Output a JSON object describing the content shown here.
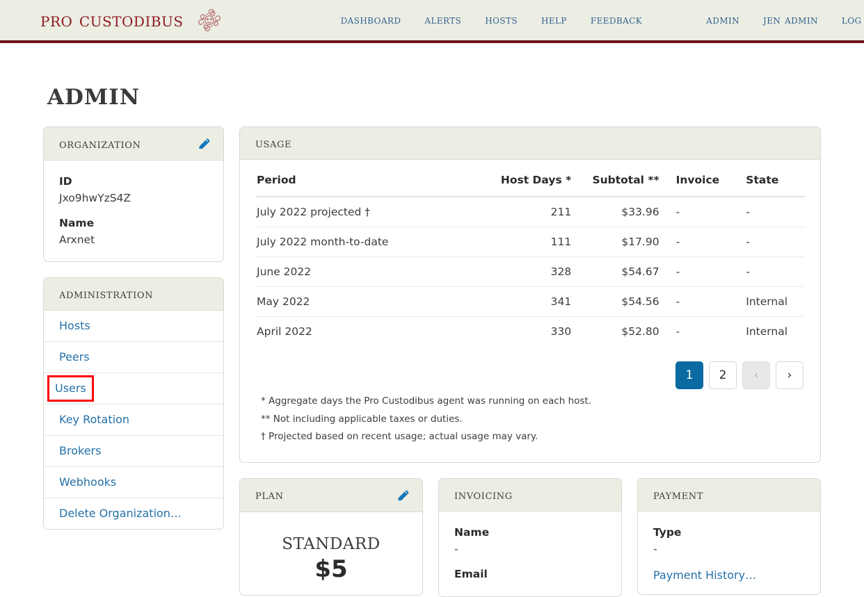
{
  "header": {
    "brand": "Pro Custodibus",
    "brand_icon": "medusa-head-logo",
    "nav_primary": [
      {
        "label": "Dashboard",
        "name": "nav-dashboard"
      },
      {
        "label": "Alerts",
        "name": "nav-alerts"
      },
      {
        "label": "Hosts",
        "name": "nav-hosts"
      },
      {
        "label": "Help",
        "name": "nav-help"
      },
      {
        "label": "Feedback",
        "name": "nav-feedback"
      }
    ],
    "nav_account": [
      {
        "label": "Admin",
        "name": "nav-admin"
      },
      {
        "label": "Jen Admin",
        "name": "nav-jen-admin"
      },
      {
        "label": "Log Out",
        "name": "nav-log-out"
      }
    ],
    "accent_color": "#6d1216",
    "link_color": "#31618e",
    "background": "#eceee4"
  },
  "page": {
    "title": "Admin"
  },
  "organization": {
    "heading": "Organization",
    "edit_icon": "pencil-icon",
    "id_label": "ID",
    "id_value": "Jxo9hwYzS4Z",
    "name_label": "Name",
    "name_value": "Arxnet"
  },
  "administration": {
    "heading": "Administration",
    "items": [
      {
        "label": "Hosts",
        "name": "admin-link-hosts",
        "highlighted": false
      },
      {
        "label": "Peers",
        "name": "admin-link-peers",
        "highlighted": false
      },
      {
        "label": "Users",
        "name": "admin-link-users",
        "highlighted": true
      },
      {
        "label": "Key Rotation",
        "name": "admin-link-key-rotation",
        "highlighted": false
      },
      {
        "label": "Brokers",
        "name": "admin-link-brokers",
        "highlighted": false
      },
      {
        "label": "Webhooks",
        "name": "admin-link-webhooks",
        "highlighted": false
      },
      {
        "label": "Delete Organization…",
        "name": "admin-link-delete-organization",
        "highlighted": false
      }
    ],
    "highlight_color": "#fe0000"
  },
  "usage": {
    "heading": "Usage",
    "columns": [
      "Period",
      "Host Days *",
      "Subtotal **",
      "Invoice",
      "State"
    ],
    "rows": [
      {
        "period": "July 2022 projected †",
        "host_days": "211",
        "subtotal": "$33.96",
        "invoice": "-",
        "state": "-"
      },
      {
        "period": "July 2022 month-to-date",
        "host_days": "111",
        "subtotal": "$17.90",
        "invoice": "-",
        "state": "-"
      },
      {
        "period": "June 2022",
        "host_days": "328",
        "subtotal": "$54.67",
        "invoice": "-",
        "state": "-"
      },
      {
        "period": "May 2022",
        "host_days": "341",
        "subtotal": "$54.56",
        "invoice": "-",
        "state": "Internal"
      },
      {
        "period": "April 2022",
        "host_days": "330",
        "subtotal": "$52.80",
        "invoice": "-",
        "state": "Internal"
      }
    ],
    "pagination": {
      "pages": [
        "1",
        "2"
      ],
      "current": "1",
      "prev_icon": "‹",
      "next_icon": "›",
      "prev_disabled": true,
      "active_color": "#0a6aa1"
    },
    "footnotes": [
      "* Aggregate days the Pro Custodibus agent was running on each host.",
      "** Not including applicable taxes or duties.",
      "† Projected based on recent usage; actual usage may vary."
    ]
  },
  "plan": {
    "heading": "Plan",
    "edit_icon": "pencil-icon",
    "name": "Standard",
    "price": "$5"
  },
  "invoicing": {
    "heading": "Invoicing",
    "name_label": "Name",
    "name_value": "-",
    "email_label": "Email"
  },
  "payment": {
    "heading": "Payment",
    "type_label": "Type",
    "type_value": "-",
    "history_link": "Payment History…"
  }
}
